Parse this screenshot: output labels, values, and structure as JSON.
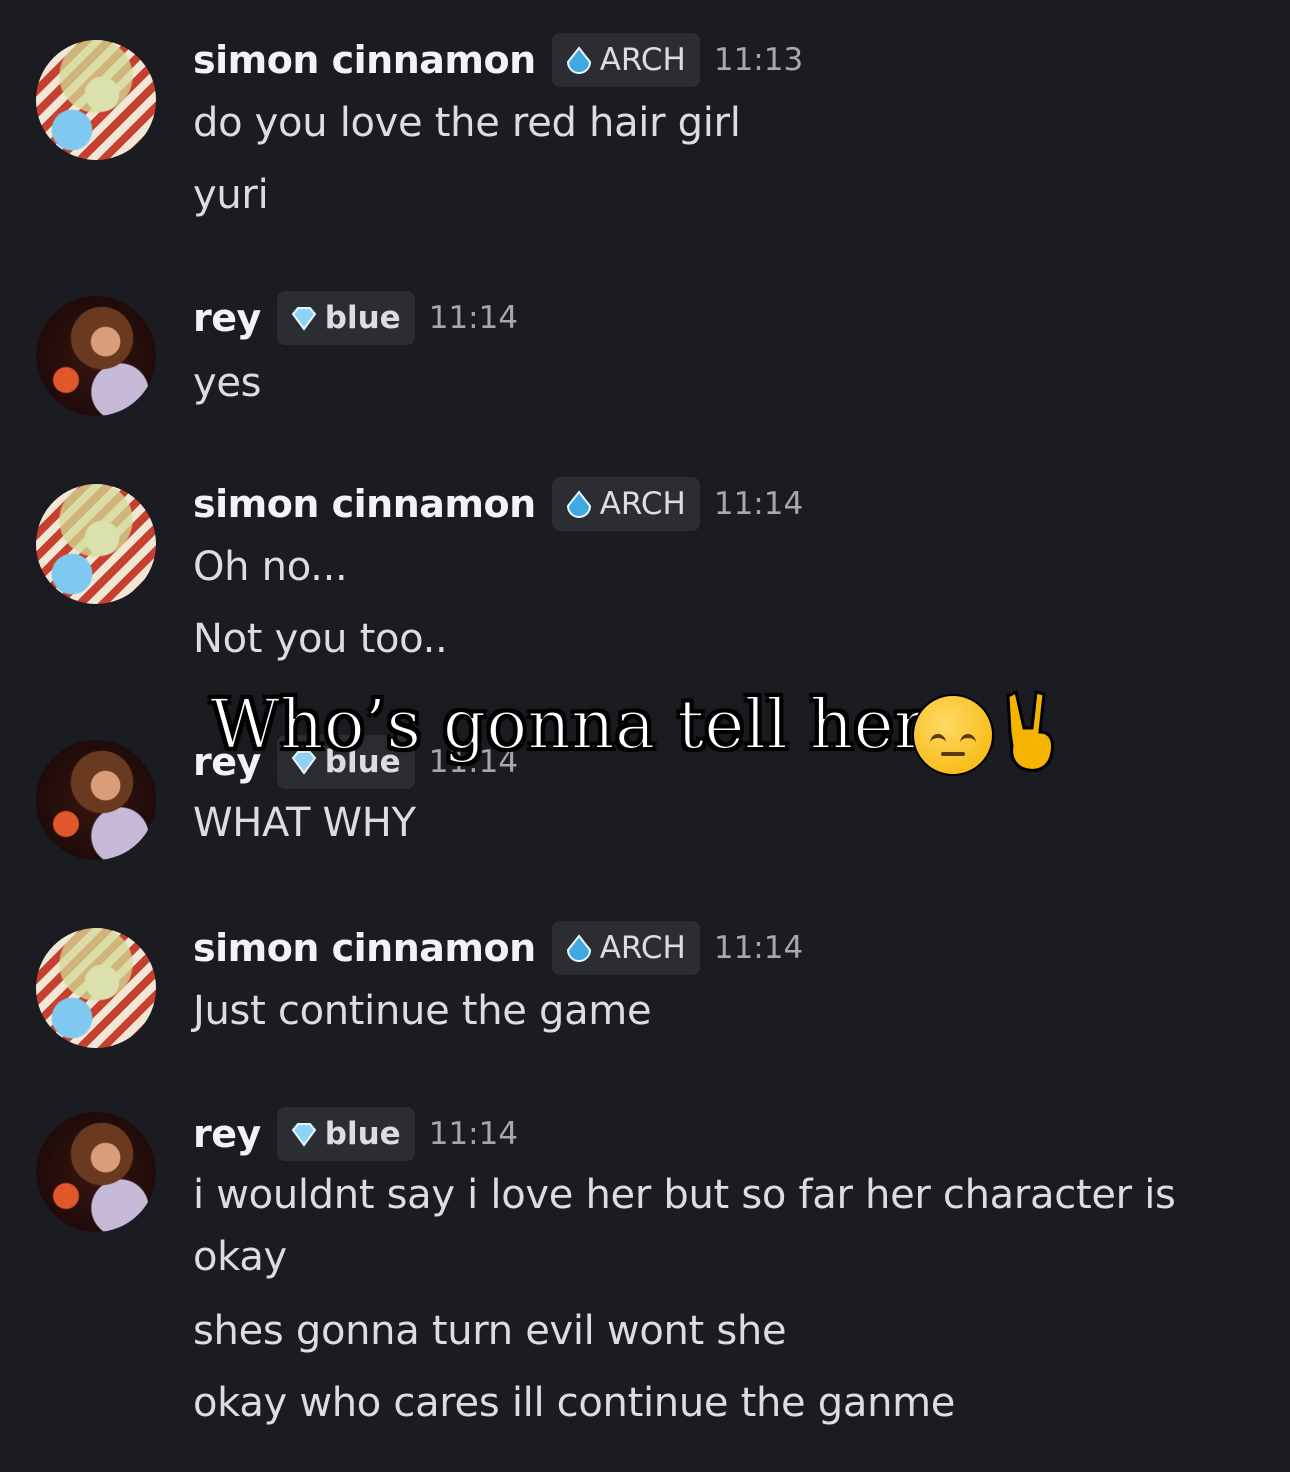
{
  "messages": [
    {
      "author": "simon cinnamon",
      "avatar": "simon-avatar",
      "tag": "ARCH",
      "tag_icon": "water-drop-icon",
      "time": "11:13",
      "lines": [
        "do you love the red hair girl",
        "yuri"
      ]
    },
    {
      "author": "rey",
      "avatar": "rey-avatar",
      "tag": "blue",
      "tag_icon": "diamond-icon",
      "time": "11:14",
      "lines": [
        "yes"
      ]
    },
    {
      "author": "simon cinnamon",
      "avatar": "simon-avatar",
      "tag": "ARCH",
      "tag_icon": "water-drop-icon",
      "time": "11:14",
      "lines": [
        "Oh no...",
        "Not you too.."
      ]
    },
    {
      "author": "rey",
      "avatar": "rey-avatar",
      "tag": "blue",
      "tag_icon": "diamond-icon",
      "time": "11:14",
      "lines": [
        "WHAT WHY"
      ]
    },
    {
      "author": "simon cinnamon",
      "avatar": "simon-avatar",
      "tag": "ARCH",
      "tag_icon": "water-drop-icon",
      "time": "11:14",
      "lines": [
        "Just continue the game"
      ]
    },
    {
      "author": "rey",
      "avatar": "rey-avatar",
      "tag": "blue",
      "tag_icon": "diamond-icon",
      "time": "11:14",
      "lines": [
        "i wouldnt say i love her but so far her character is",
        "okay",
        "shes gonna turn evil wont she",
        "okay who cares ill continue the ganme"
      ]
    }
  ],
  "overlay": {
    "caption": "Who’s gonna tell her",
    "emojis": [
      "pensive-face-emoji",
      "victory-hand-emoji"
    ]
  },
  "colors": {
    "background": "#1b1c21",
    "tag_background": "#2b2d33",
    "text": "#dcdde1",
    "username": "#f2f3f5",
    "timestamp": "#a6a8ad",
    "arch_drop": "#3fa9e0",
    "blue_diamond": "#8fd3f4"
  }
}
